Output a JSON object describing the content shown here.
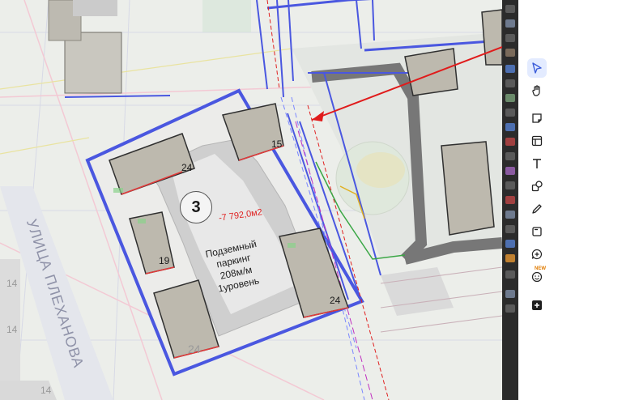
{
  "plan": {
    "street_name": "УЛИЦА ПЛЕХАНОВА",
    "section_number": "3",
    "area": "-7 792,0м2",
    "parking_lines": [
      "Подземный",
      "паркинг",
      "208м/м",
      "1уровень"
    ],
    "floors_a": "24",
    "floors_b": "15",
    "floors_c": "19",
    "floors_d": "24",
    "floors_e": "24",
    "block_small_1": "14",
    "block_small_2": "14",
    "block_small_3": "14"
  },
  "toolbar": {
    "items": [
      {
        "name": "select-tool",
        "icon": "cursor-icon",
        "active": true
      },
      {
        "name": "hand-tool",
        "icon": "hand-icon",
        "active": false
      },
      {
        "name": "sticky-note-tool",
        "icon": "sticky-note-icon",
        "active": false
      },
      {
        "name": "template-tool",
        "icon": "layout-icon",
        "active": false
      },
      {
        "name": "text-tool",
        "icon": "text-icon",
        "active": false
      },
      {
        "name": "shapes-tool",
        "icon": "shapes-icon",
        "active": false
      },
      {
        "name": "pen-tool",
        "icon": "pen-icon",
        "active": false
      },
      {
        "name": "frame-tool",
        "icon": "frame-icon",
        "active": false
      },
      {
        "name": "comment-tool",
        "icon": "comment-add-icon",
        "active": false
      },
      {
        "name": "reactions-tool",
        "icon": "emoji-icon",
        "active": false
      },
      {
        "name": "more-tool",
        "icon": "plus-box-icon",
        "active": false
      }
    ],
    "new_badge": "NEW"
  },
  "colors": {
    "blue_line": "#4a57e0",
    "red_line": "#e02020",
    "building_fill": "#b8b3a8",
    "annotation_red": "#e01b1b"
  }
}
